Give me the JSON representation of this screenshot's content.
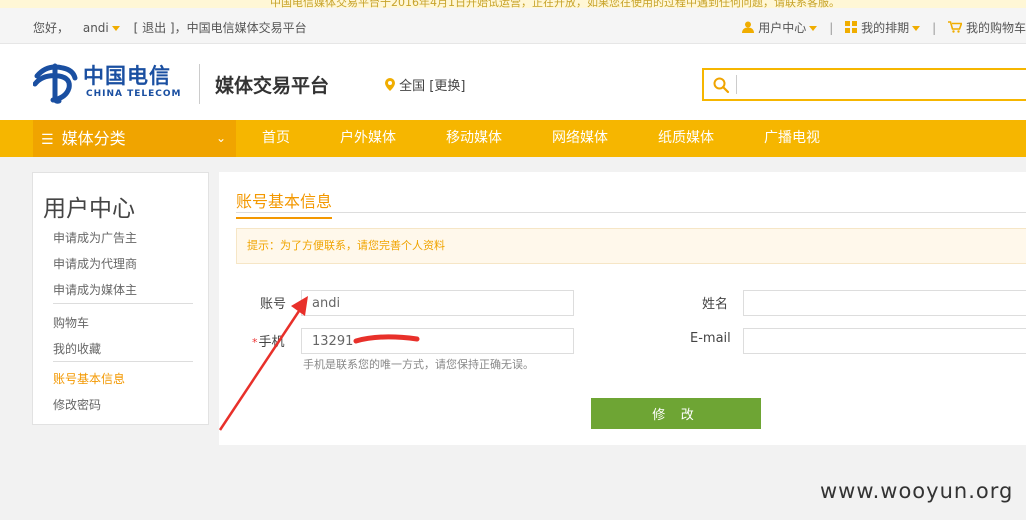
{
  "announcement": "中国电信媒体交易平台于2016年4月1日开始试运营，正在开放，如果您在使用的过程中遇到任何问题，请联系客服。",
  "topbar": {
    "greeting": "您好，",
    "username": "andi",
    "logout": "[ 退出 ]",
    "site_name": "中国电信媒体交易平台",
    "user_center": "用户中心",
    "my_schedule": "我的排期",
    "cart": "我的购物车"
  },
  "header": {
    "logo_cn": "中国电信",
    "logo_en": "CHINA TELECOM",
    "platform": "媒体交易平台",
    "location": "全国 [更换]",
    "search_placeholder": ""
  },
  "nav": {
    "category": "媒体分类",
    "items": [
      "首页",
      "户外媒体",
      "移动媒体",
      "网络媒体",
      "纸质媒体",
      "广播电视"
    ]
  },
  "sidebar": {
    "title": "用户中心",
    "group1": [
      "申请成为广告主",
      "申请成为代理商",
      "申请成为媒体主"
    ],
    "group2": [
      "购物车",
      "我的收藏"
    ],
    "group3": [
      "账号基本信息",
      "修改密码"
    ]
  },
  "main": {
    "tab_title": "账号基本信息",
    "tip": "提示：为了方便联系，请您完善个人资料",
    "account_label": "账号",
    "account_value": "andi",
    "name_label": "姓名",
    "name_value": "",
    "phone_label": "手机",
    "phone_required": "*",
    "phone_value": "13291",
    "email_label": "E-mail",
    "email_value": "",
    "phone_hint": "手机是联系您的唯一方式，请您保持正确无误。",
    "submit": "修 改"
  },
  "watermark": "www.wooyun.org",
  "colors": {
    "accent": "#f6b600",
    "brand": "#1a4fa1",
    "submit": "#6ea534",
    "annotation": "#e8302a"
  }
}
